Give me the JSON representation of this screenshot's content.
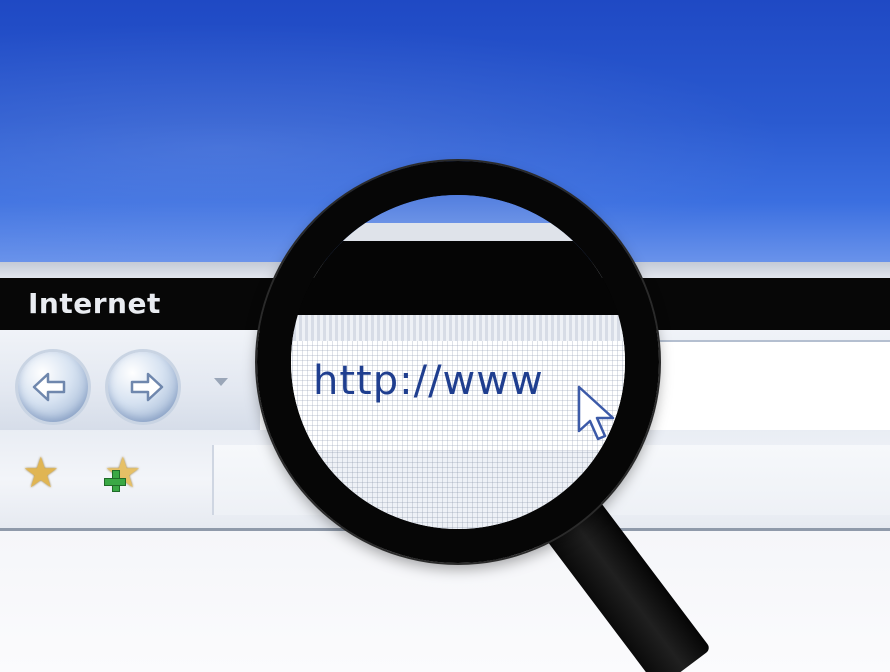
{
  "window": {
    "title": "Internet"
  },
  "address_bar": {
    "url_text": "http://www"
  },
  "toolbar": {
    "back_icon": "back-arrow-icon",
    "forward_icon": "forward-arrow-icon",
    "dropdown_icon": "chevron-down-icon"
  },
  "favorites": {
    "favorites_icon": "star-icon",
    "add_favorite_icon": "add-star-icon"
  },
  "colors": {
    "desktop_blue": "#2a5ad0",
    "title_bar": "#070707",
    "url_text": "#1f3e8f",
    "magnifier": "#060606"
  }
}
